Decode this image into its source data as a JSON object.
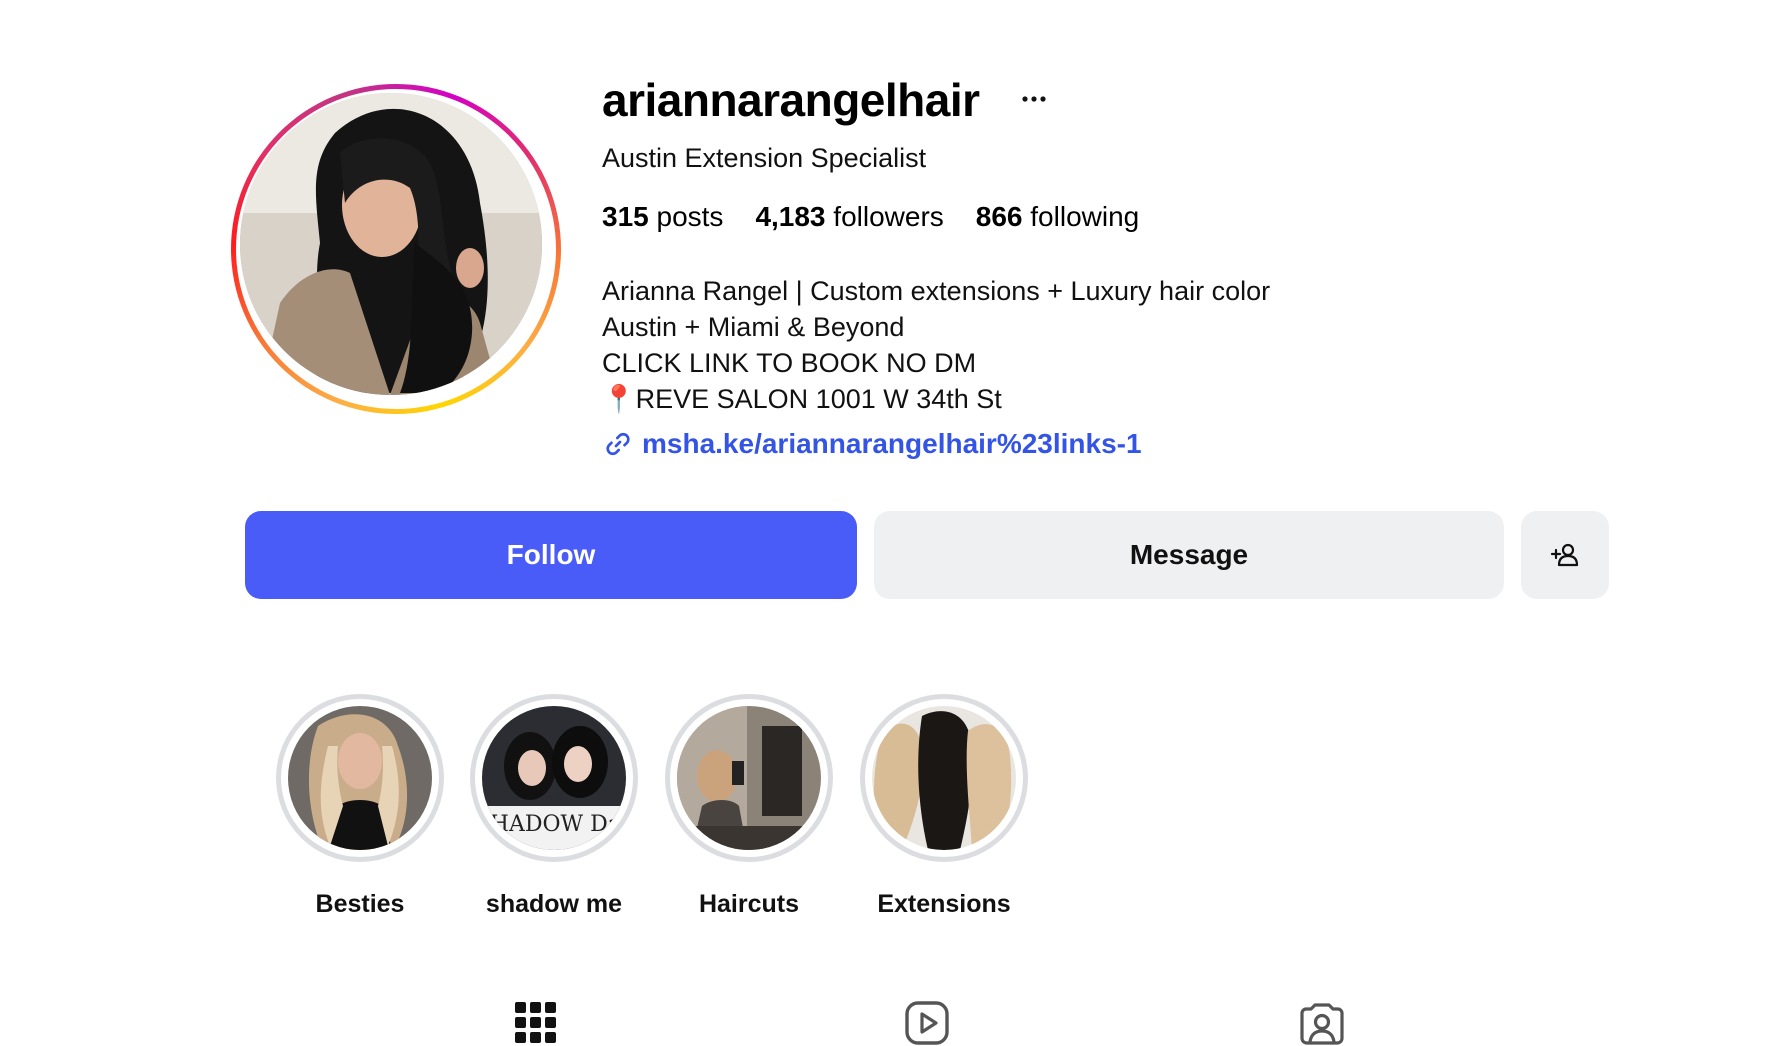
{
  "profile": {
    "username": "ariannarangelhair",
    "category": "Austin Extension Specialist",
    "stats": [
      {
        "count": "315",
        "label": "posts"
      },
      {
        "count": "4,183",
        "label": "followers"
      },
      {
        "count": "866",
        "label": "following"
      }
    ],
    "bio": [
      "Arianna Rangel | Custom extensions + Luxury hair color",
      "Austin + Miami & Beyond",
      "CLICK LINK TO BOOK NO DM"
    ],
    "location_pin": "📍",
    "location": "REVE SALON 1001 W 34th St",
    "link": "msha.ke/ariannarangelhair%23links-1"
  },
  "actions": {
    "follow": "Follow",
    "message": "Message",
    "more_icon": "more-icon",
    "add_user_icon": "add-user-icon"
  },
  "highlights": [
    {
      "label": "Besties"
    },
    {
      "label": "shadow me",
      "image_text": "SHADOW Day"
    },
    {
      "label": "Haircuts"
    },
    {
      "label": "Extensions"
    }
  ],
  "tabs": [
    {
      "icon": "grid-icon"
    },
    {
      "icon": "reels-icon"
    },
    {
      "icon": "tagged-icon"
    }
  ],
  "colors": {
    "follow_button": "#4a5cf8",
    "secondary_button": "#eff0f2",
    "link": "#3454e6"
  }
}
